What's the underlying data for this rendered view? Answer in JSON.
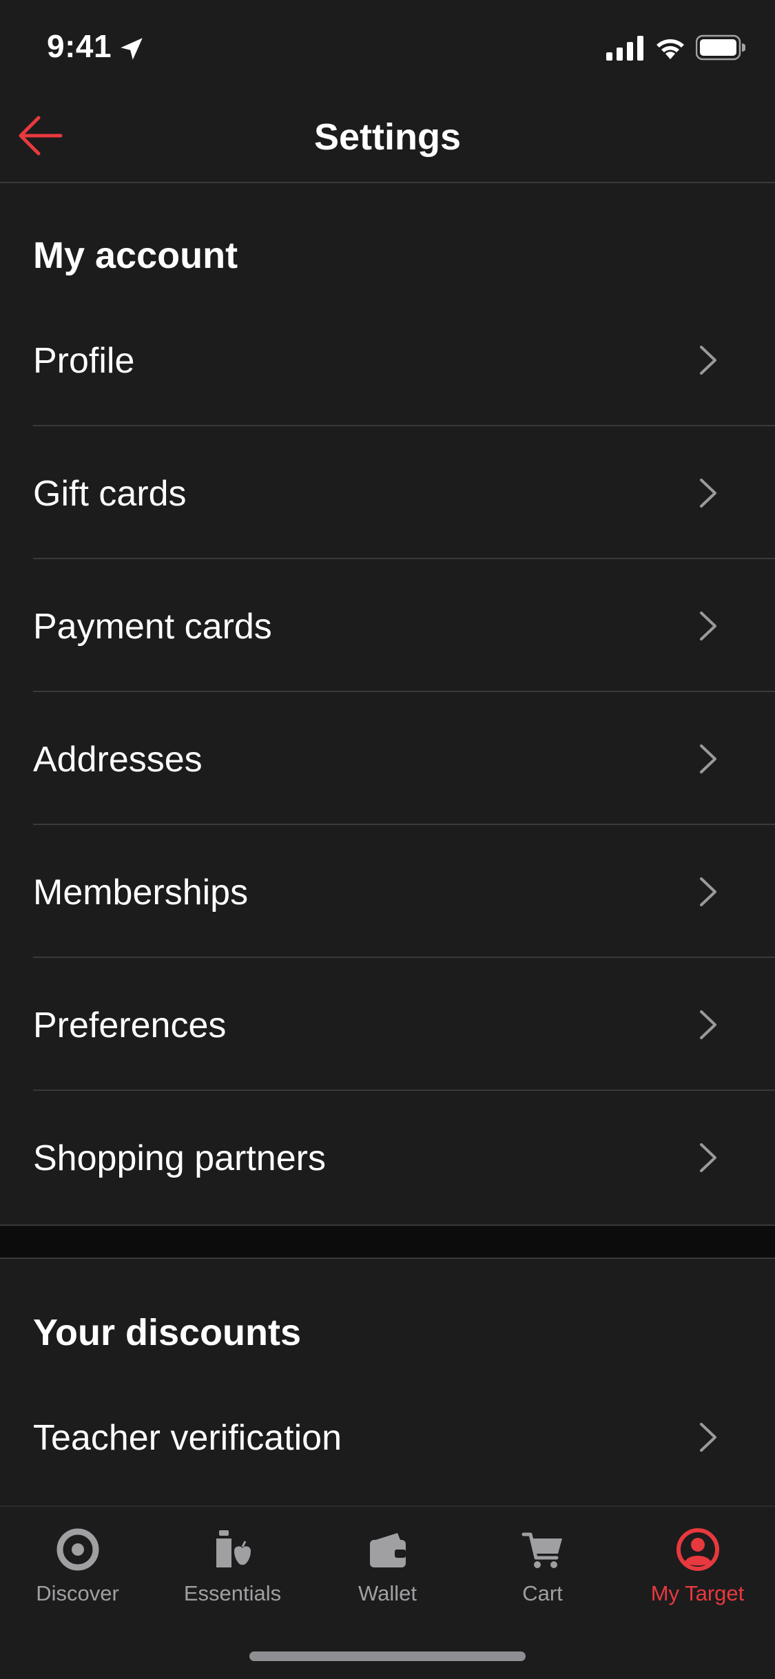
{
  "status_bar": {
    "time": "9:41"
  },
  "header": {
    "title": "Settings"
  },
  "sections": [
    {
      "title": "My account",
      "items": [
        {
          "label": "Profile"
        },
        {
          "label": "Gift cards"
        },
        {
          "label": "Payment cards"
        },
        {
          "label": "Addresses"
        },
        {
          "label": "Memberships"
        },
        {
          "label": "Preferences"
        },
        {
          "label": "Shopping partners"
        }
      ]
    },
    {
      "title": "Your discounts",
      "items": [
        {
          "label": "Teacher verification"
        }
      ]
    }
  ],
  "tab_bar": {
    "tabs": [
      {
        "label": "Discover",
        "icon": "target-bullseye-icon"
      },
      {
        "label": "Essentials",
        "icon": "essentials-icon"
      },
      {
        "label": "Wallet",
        "icon": "wallet-icon"
      },
      {
        "label": "Cart",
        "icon": "cart-icon"
      },
      {
        "label": "My Target",
        "icon": "account-icon"
      }
    ],
    "active": "My Target"
  },
  "colors": {
    "accent": "#e8393e",
    "background": "#1c1c1d",
    "inactive": "#a0a0a3"
  }
}
